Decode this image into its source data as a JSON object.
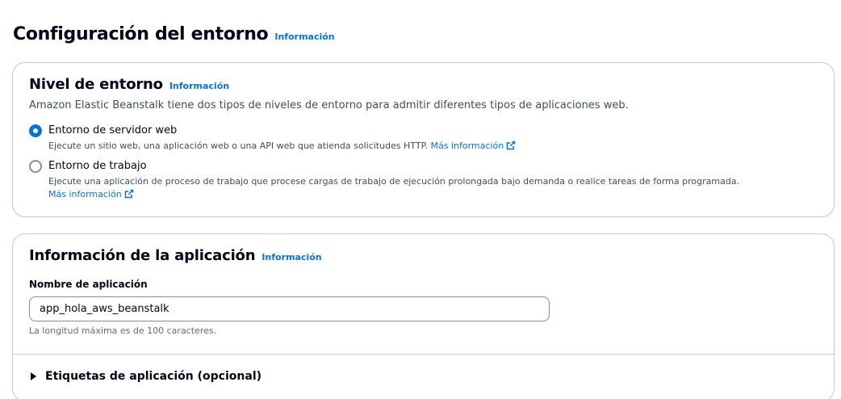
{
  "page": {
    "title": "Configuración del entorno",
    "info_label": "Información"
  },
  "environment_tier": {
    "title": "Nivel de entorno",
    "info_label": "Información",
    "description": "Amazon Elastic Beanstalk tiene dos tipos de niveles de entorno para admitir diferentes tipos de aplicaciones web.",
    "options": [
      {
        "label": "Entorno de servidor web",
        "description": "Ejecute un sitio web, una aplicación web o una API web que atienda solicitudes HTTP.",
        "link": "Más información",
        "selected": true
      },
      {
        "label": "Entorno de trabajo",
        "description": "Ejecute una aplicación de proceso de trabajo que procese cargas de trabajo de ejecución prolongada bajo demanda o realice tareas de forma programada.",
        "link": "Más información",
        "selected": false
      }
    ]
  },
  "application_info": {
    "title": "Información de la aplicación",
    "info_label": "Información",
    "name_label": "Nombre de aplicación",
    "name_value": "app_hola_aws_beanstalk",
    "name_hint": "La longitud máxima es de 100 caracteres.",
    "tags_label": "Etiquetas de aplicación (opcional)"
  },
  "icons": {
    "external_link": "external-link-icon",
    "expand": "caret-right-icon"
  },
  "colors": {
    "link": "#0972d3",
    "text": "#000716",
    "border": "#c6c6cd"
  }
}
